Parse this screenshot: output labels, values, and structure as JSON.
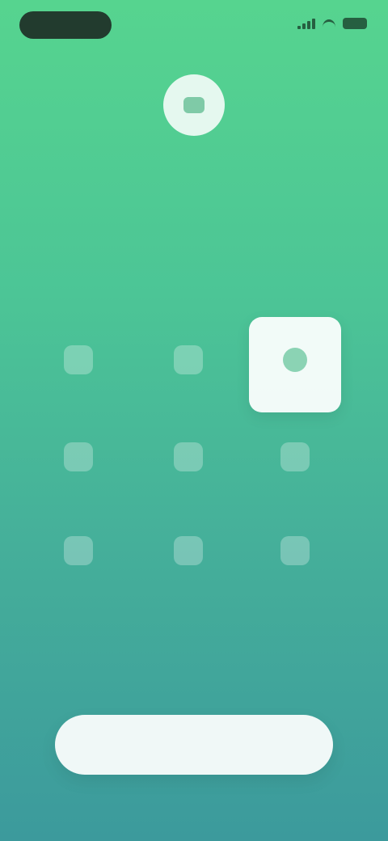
{
  "status_bar": {
    "icons": [
      "signal-icon",
      "wifi-icon",
      "battery-icon"
    ]
  },
  "header": {
    "icon": "avatar-icon",
    "title": "",
    "subtitle": ""
  },
  "grid": {
    "tiles": [
      {
        "label": "",
        "icon": "option-icon",
        "selected": false
      },
      {
        "label": "",
        "icon": "option-icon",
        "selected": false
      },
      {
        "label": "",
        "icon": "option-icon",
        "selected": true
      },
      {
        "label": "",
        "icon": "option-icon",
        "selected": false
      },
      {
        "label": "",
        "icon": "option-icon",
        "selected": false
      },
      {
        "label": "",
        "icon": "option-icon",
        "selected": false
      },
      {
        "label": "",
        "icon": "option-icon",
        "selected": false
      },
      {
        "label": "",
        "icon": "option-icon",
        "selected": false
      },
      {
        "label": "",
        "icon": "option-icon",
        "selected": false
      }
    ]
  },
  "cta": {
    "label": ""
  },
  "colors": {
    "gradient_top": "#56d48f",
    "gradient_bottom": "#3c9a9c",
    "accent": "#67b79a"
  }
}
